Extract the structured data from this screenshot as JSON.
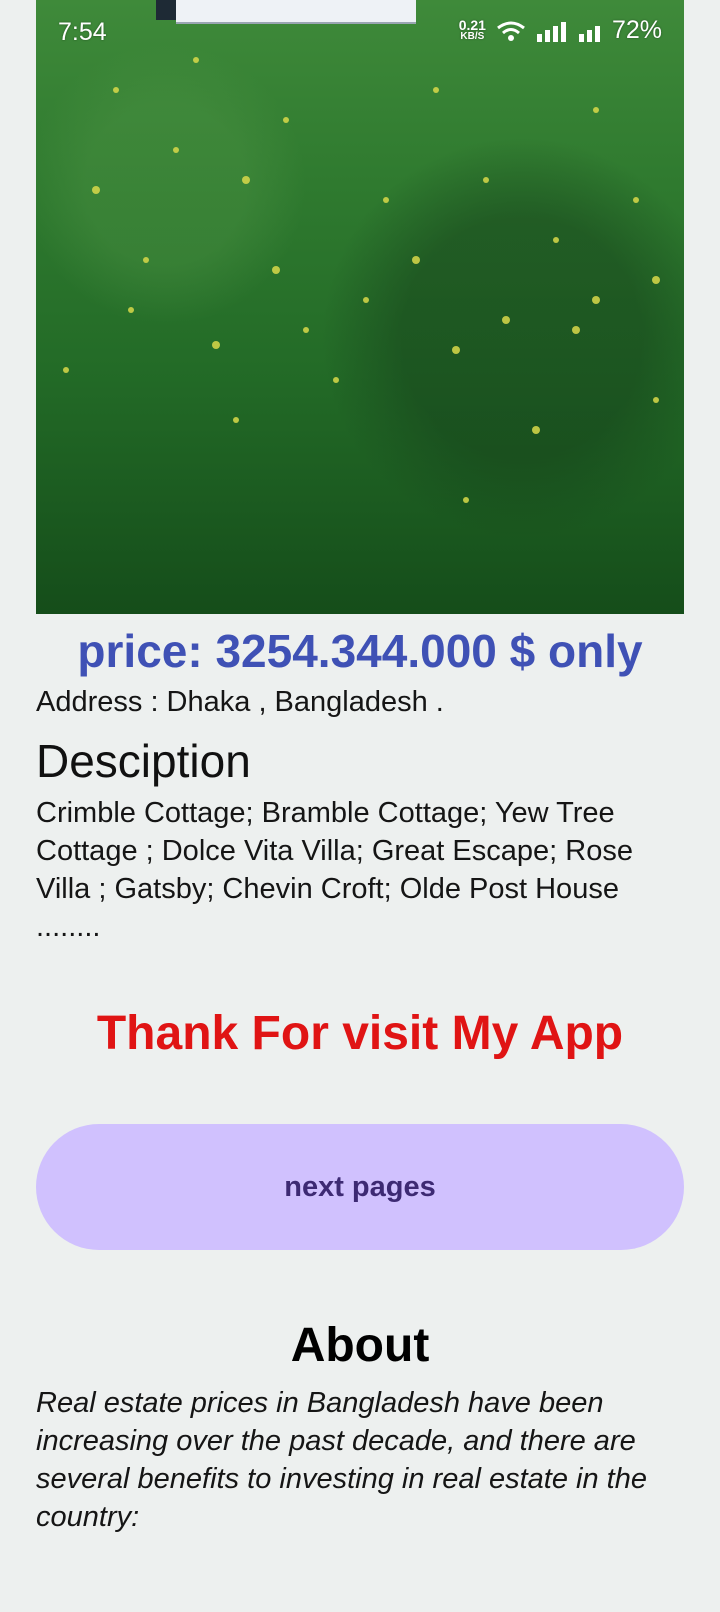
{
  "status_bar": {
    "time": "7:54",
    "net_speed_value": "0.21",
    "net_speed_unit": "KB/S",
    "battery": "72%"
  },
  "hero_image": {
    "icon": "grass-field-photo"
  },
  "listing": {
    "price": "price: 3254.344.000 $ only",
    "address": "Address : Dhaka , Bangladesh .",
    "description_heading": "Desciption",
    "description": "Crimble Cottage; Bramble Cottage; Yew Tree Cottage ; Dolce Vita Villa; Great Escape; Rose Villa ; Gatsby; Chevin Croft; Olde Post House ........"
  },
  "thanks_text": "Thank For visit My App",
  "next_button_label": "next pages",
  "about": {
    "heading": "About",
    "text": "Real estate prices in Bangladesh have been increasing over the past decade, and there are several benefits to investing in real estate in the country:"
  },
  "colors": {
    "background": "#edf0ef",
    "price": "#3f51b5",
    "thanks": "#e01414",
    "button_bg": "#d0c1fe",
    "button_text": "#3d2a73"
  }
}
